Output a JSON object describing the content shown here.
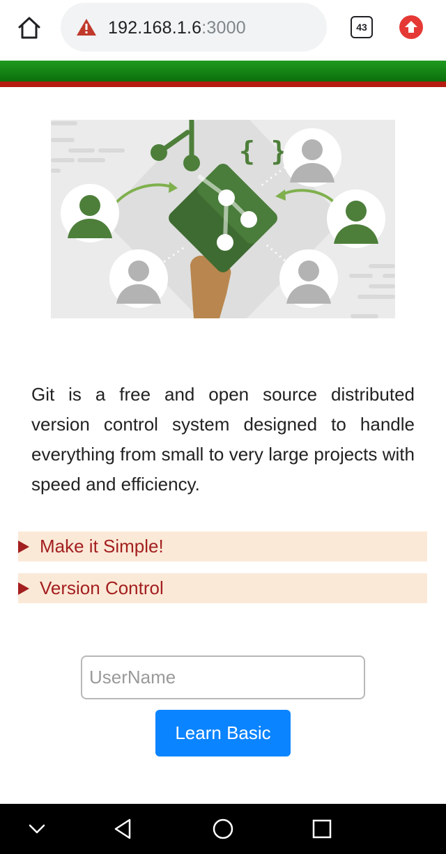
{
  "browser": {
    "url_host": "192.168.1.6",
    "url_port": ":3000",
    "tab_count": "43",
    "icons": [
      "home-icon",
      "warning-icon",
      "tabs-icon",
      "update-icon"
    ],
    "warning_color": "#c0392b",
    "update_color": "#e53935"
  },
  "header": {
    "stripe_green": "#138a13",
    "stripe_red": "#b51b10"
  },
  "hero": {
    "braces_text": "{ }",
    "icon": "git-collaboration-illustration"
  },
  "main": {
    "description": "Git is a free and open source distributed version control system designed to handle everything from small to very large projects with speed and efficiency.",
    "summaries": [
      {
        "label": "Make it Simple!"
      },
      {
        "label": "Version Control"
      }
    ]
  },
  "form": {
    "username_placeholder": "UserName",
    "username_value": "",
    "submit_label": "Learn Basic",
    "submit_color": "#0b84ff"
  },
  "android_nav": {
    "icons": [
      "chevron-down-icon",
      "back-icon",
      "home-circle-icon",
      "recents-icon"
    ]
  }
}
